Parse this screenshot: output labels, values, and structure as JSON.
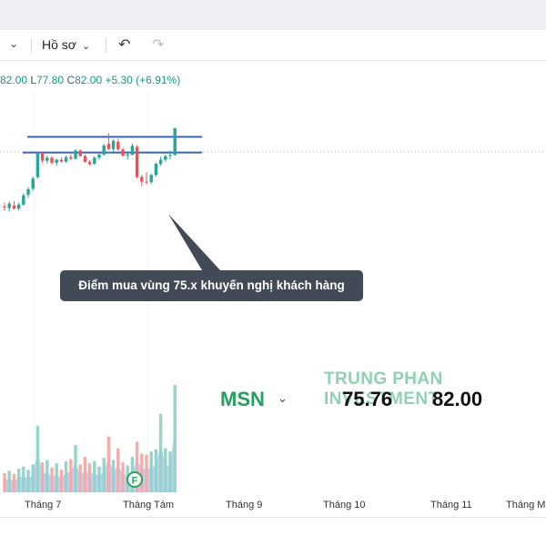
{
  "toolbar": {
    "profile_label": "Hồ sơ",
    "undo_icon": "undo-icon",
    "redo_icon": "redo-icon"
  },
  "ohlc": {
    "open_value": "82.00",
    "low_label": "L",
    "low_value": "77.80",
    "close_label": "C",
    "close_value": "82.00",
    "change": "+5.30 (+6.91%)"
  },
  "annotation": {
    "text": "Điểm mua vùng 75.x khuyến nghị khách hàng"
  },
  "overlay": {
    "brand": "TRUNG PHAN INVESTMENT",
    "ticker": "MSN",
    "value_1": "75.76",
    "value_2": "82.00"
  },
  "xaxis": {
    "labels": [
      "Tháng 7",
      "Tháng Tám",
      "Tháng 9",
      "Tháng 10",
      "Tháng 11",
      "Tháng Mư"
    ]
  },
  "event_marker": "F",
  "colors": {
    "up": "#26a69a",
    "down": "#ef5350",
    "level_lines": "#3b63c4",
    "brand": "#8fd1b4",
    "ticker": "#22a05e"
  },
  "chart_data": {
    "type": "candlestick",
    "currency_unit": "thousand VND",
    "y_range_visible": [
      62,
      84
    ],
    "levels": [
      80.3,
      77.2
    ],
    "candles": [
      {
        "o": 66.6,
        "h": 67.4,
        "l": 65.8,
        "c": 66.4
      },
      {
        "o": 66.3,
        "h": 67.6,
        "l": 65.6,
        "c": 67.2
      },
      {
        "o": 66.8,
        "h": 67.7,
        "l": 66.0,
        "c": 66.2
      },
      {
        "o": 66.2,
        "h": 67.4,
        "l": 65.9,
        "c": 67.0
      },
      {
        "o": 67.0,
        "h": 69.2,
        "l": 66.8,
        "c": 68.8
      },
      {
        "o": 68.9,
        "h": 70.4,
        "l": 68.3,
        "c": 70.0
      },
      {
        "o": 70.1,
        "h": 72.5,
        "l": 69.7,
        "c": 72.1
      },
      {
        "o": 72.4,
        "h": 77.3,
        "l": 72.1,
        "c": 77.0
      },
      {
        "o": 77.0,
        "h": 77.4,
        "l": 75.2,
        "c": 75.6
      },
      {
        "o": 75.6,
        "h": 76.6,
        "l": 75.1,
        "c": 76.2
      },
      {
        "o": 76.2,
        "h": 76.5,
        "l": 74.9,
        "c": 75.2
      },
      {
        "o": 75.2,
        "h": 76.0,
        "l": 74.6,
        "c": 75.8
      },
      {
        "o": 75.8,
        "h": 76.3,
        "l": 75.3,
        "c": 75.4
      },
      {
        "o": 75.4,
        "h": 76.6,
        "l": 75.2,
        "c": 76.3
      },
      {
        "o": 76.3,
        "h": 76.9,
        "l": 75.7,
        "c": 76.0
      },
      {
        "o": 76.0,
        "h": 77.9,
        "l": 75.8,
        "c": 77.6
      },
      {
        "o": 77.6,
        "h": 77.8,
        "l": 76.4,
        "c": 76.5
      },
      {
        "o": 76.5,
        "h": 76.8,
        "l": 75.2,
        "c": 75.4
      },
      {
        "o": 75.4,
        "h": 75.7,
        "l": 74.7,
        "c": 74.9
      },
      {
        "o": 75.0,
        "h": 76.5,
        "l": 74.8,
        "c": 76.2
      },
      {
        "o": 76.2,
        "h": 77.0,
        "l": 75.8,
        "c": 76.8
      },
      {
        "o": 76.8,
        "h": 78.9,
        "l": 76.6,
        "c": 78.6
      },
      {
        "o": 78.9,
        "h": 81.0,
        "l": 77.7,
        "c": 77.9
      },
      {
        "o": 77.9,
        "h": 79.8,
        "l": 77.4,
        "c": 79.5
      },
      {
        "o": 79.3,
        "h": 79.9,
        "l": 77.6,
        "c": 77.8
      },
      {
        "o": 77.8,
        "h": 78.2,
        "l": 76.4,
        "c": 76.6
      },
      {
        "o": 76.6,
        "h": 77.1,
        "l": 75.8,
        "c": 76.8
      },
      {
        "o": 76.8,
        "h": 79.0,
        "l": 76.6,
        "c": 78.5
      },
      {
        "o": 78.3,
        "h": 78.7,
        "l": 72.1,
        "c": 72.4
      },
      {
        "o": 72.4,
        "h": 72.8,
        "l": 70.6,
        "c": 71.5
      },
      {
        "o": 71.5,
        "h": 73.3,
        "l": 71.0,
        "c": 71.4
      },
      {
        "o": 71.4,
        "h": 73.1,
        "l": 71.0,
        "c": 72.8
      },
      {
        "o": 72.8,
        "h": 75.2,
        "l": 72.5,
        "c": 75.0
      },
      {
        "o": 75.0,
        "h": 76.4,
        "l": 74.6,
        "c": 75.8
      },
      {
        "o": 75.8,
        "h": 76.8,
        "l": 75.4,
        "c": 76.5
      },
      {
        "o": 76.5,
        "h": 77.6,
        "l": 75.9,
        "c": 76.7
      },
      {
        "o": 76.7,
        "h": 82.0,
        "l": 77.8,
        "c": 82.0
      }
    ],
    "volume": [
      0.18,
      0.2,
      0.17,
      0.22,
      0.24,
      0.21,
      0.26,
      0.62,
      0.28,
      0.3,
      0.23,
      0.27,
      0.21,
      0.29,
      0.31,
      0.44,
      0.26,
      0.33,
      0.27,
      0.29,
      0.24,
      0.32,
      0.52,
      0.3,
      0.41,
      0.28,
      0.25,
      0.33,
      0.47,
      0.36,
      0.35,
      0.38,
      0.4,
      0.73,
      0.41,
      0.38,
      1.0
    ]
  }
}
